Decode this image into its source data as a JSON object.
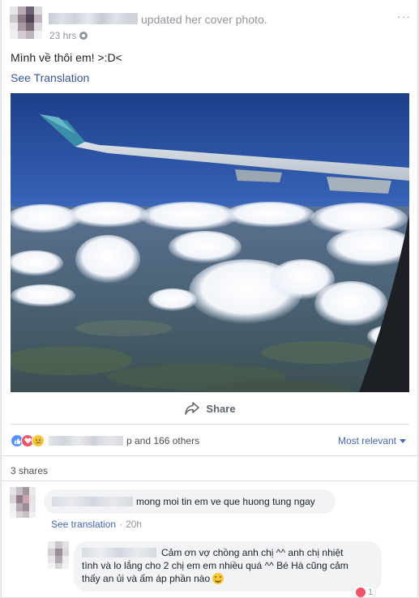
{
  "header": {
    "updated_text": "updated her cover photo.",
    "time": "23 hrs",
    "more_glyph": "···"
  },
  "post": {
    "text": "Mình về thôi em! >:D<",
    "see_translation": "See Translation",
    "photo_icon": "airplane-window-photo"
  },
  "actions": {
    "share_label": "Share",
    "share_icon": "share-arrow-icon"
  },
  "reactions": {
    "summary_text": "p and 166 others",
    "sort_label": "Most relevant",
    "types": [
      "like",
      "love",
      "sad"
    ],
    "colors": {
      "like": "#5890ff",
      "love": "#f25268",
      "sad": "#f7c736"
    }
  },
  "shares": {
    "label": "3 shares"
  },
  "comments": [
    {
      "text": "mong moi tin em ve que huong tung ngay",
      "see_translation": "See translation",
      "separator": "·",
      "time": "20h"
    }
  ],
  "reply": {
    "line1": "Cảm ơn vợ chồng anh chị ^^ anh chị nhiệt",
    "line2": "tình và lo lắng cho 2 chị em em nhiều quá ^^ Bé Hà cũng cảm",
    "line3": "thấy an ủi và ấm áp phần nào",
    "reaction_count": "1"
  },
  "colors": {
    "link": "#365899",
    "accent": "#4267b2",
    "muted": "#90949c",
    "bubble": "#f2f3f5"
  }
}
